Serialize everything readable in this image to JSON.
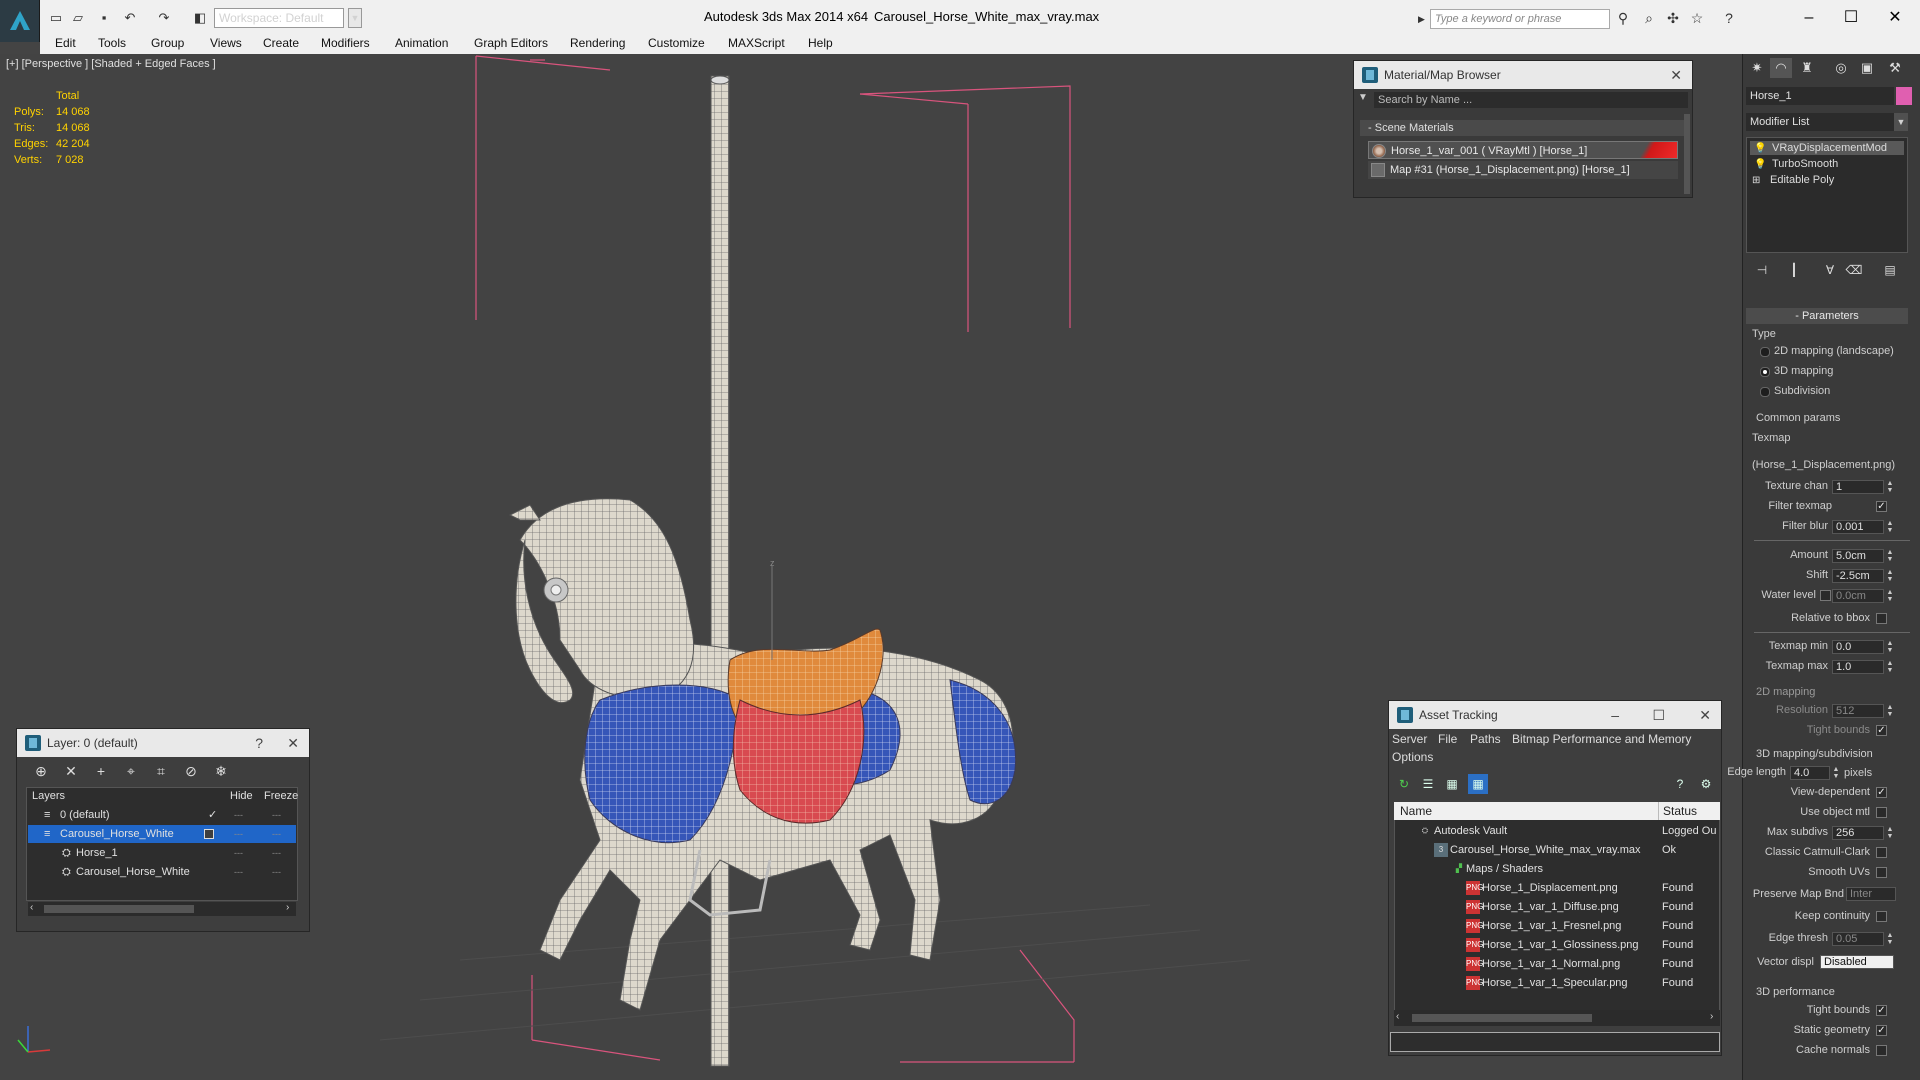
{
  "titlebar": {
    "workspace": "Workspace: Default",
    "app_title": "Autodesk 3ds Max  2014 x64",
    "file_title": "Carousel_Horse_White_max_vray.max",
    "search_placeholder": "Type a keyword or phrase"
  },
  "menu": [
    "Edit",
    "Tools",
    "Group",
    "Views",
    "Create",
    "Modifiers",
    "Animation",
    "Graph Editors",
    "Rendering",
    "Customize",
    "MAXScript",
    "Help"
  ],
  "viewport": {
    "label": "[+] [Perspective ] [Shaded + Edged Faces ]",
    "stats_header": "Total",
    "stats": [
      {
        "label": "Polys:",
        "value": "14 068"
      },
      {
        "label": "Tris:",
        "value": "14 068"
      },
      {
        "label": "Edges:",
        "value": "42 204"
      },
      {
        "label": "Verts:",
        "value": "7 028"
      }
    ],
    "axis_label": "z"
  },
  "material_browser": {
    "title": "Material/Map Browser",
    "search": "Search by Name ...",
    "section": "Scene Materials",
    "items": [
      "Horse_1_var_001  ( VRayMtl )  [Horse_1]",
      "Map #31 (Horse_1_Displacement.png)  [Horse_1]"
    ]
  },
  "command_panel": {
    "object_name": "Horse_1",
    "object_color": "#e05fb0",
    "modifier_list": "Modifier List",
    "stack": [
      "VRayDisplacementMod",
      "TurboSmooth",
      "Editable Poly"
    ],
    "rollout": "Parameters",
    "type_label": "Type",
    "types": [
      "2D mapping (landscape)",
      "3D mapping",
      "Subdivision"
    ],
    "type_selected": 1,
    "common_params": "Common params",
    "texmap_label": "Texmap",
    "texmap_value": "(Horse_1_Displacement.png)",
    "texture_chan_label": "Texture chan",
    "texture_chan": "1",
    "filter_texmap_label": "Filter texmap",
    "filter_blur_label": "Filter blur",
    "filter_blur": "0.001",
    "amount_label": "Amount",
    "amount": "5.0cm",
    "shift_label": "Shift",
    "shift": "-2.5cm",
    "water_level_label": "Water level",
    "water_level": "0.0cm",
    "relative_bbox_label": "Relative to bbox",
    "texmap_min_label": "Texmap min",
    "texmap_min": "0.0",
    "texmap_max_label": "Texmap max",
    "texmap_max": "1.0",
    "mapping2d_label": "2D mapping",
    "resolution_label": "Resolution",
    "resolution": "512",
    "tight_bounds_label": "Tight bounds",
    "mapping3d_label": "3D mapping/subdivision",
    "edge_length_label": "Edge length",
    "edge_length": "4.0",
    "pixels_label": "pixels",
    "view_dependent_label": "View-dependent",
    "use_object_mtl_label": "Use object mtl",
    "max_subdivs_label": "Max subdivs",
    "max_subdivs": "256",
    "classic_cc_label": "Classic Catmull-Clark",
    "smooth_uvs_label": "Smooth UVs",
    "preserve_map_label": "Preserve Map Bnd",
    "preserve_map": "Inter",
    "keep_continuity_label": "Keep continuity",
    "edge_thresh_label": "Edge thresh",
    "edge_thresh": "0.05",
    "vector_displ_label": "Vector displ",
    "vector_displ": "Disabled",
    "perf_label": "3D performance",
    "perf_tight_bounds_label": "Tight bounds",
    "static_geometry_label": "Static geometry",
    "cache_normals_label": "Cache normals"
  },
  "layer_panel": {
    "title": "Layer: 0 (default)",
    "help": "?",
    "col_layers": "Layers",
    "col_hide": "Hide",
    "col_freeze": "Freeze",
    "rows": [
      "0 (default)",
      "Carousel_Horse_White",
      "Horse_1",
      "Carousel_Horse_White"
    ]
  },
  "asset_tracking": {
    "title": "Asset Tracking",
    "menu": [
      "Server",
      "File",
      "Paths",
      "Bitmap Performance and Memory",
      "Options"
    ],
    "col_name": "Name",
    "col_status": "Status",
    "rows": [
      {
        "name": "Autodesk Vault",
        "status": "Logged Ou"
      },
      {
        "name": "Carousel_Horse_White_max_vray.max",
        "status": "Ok"
      },
      {
        "name": "Maps / Shaders",
        "status": ""
      },
      {
        "name": "Horse_1_Displacement.png",
        "status": "Found"
      },
      {
        "name": "Horse_1_var_1_Diffuse.png",
        "status": "Found"
      },
      {
        "name": "Horse_1_var_1_Fresnel.png",
        "status": "Found"
      },
      {
        "name": "Horse_1_var_1_Glossiness.png",
        "status": "Found"
      },
      {
        "name": "Horse_1_var_1_Normal.png",
        "status": "Found"
      },
      {
        "name": "Horse_1_var_1_Specular.png",
        "status": "Found"
      }
    ]
  }
}
